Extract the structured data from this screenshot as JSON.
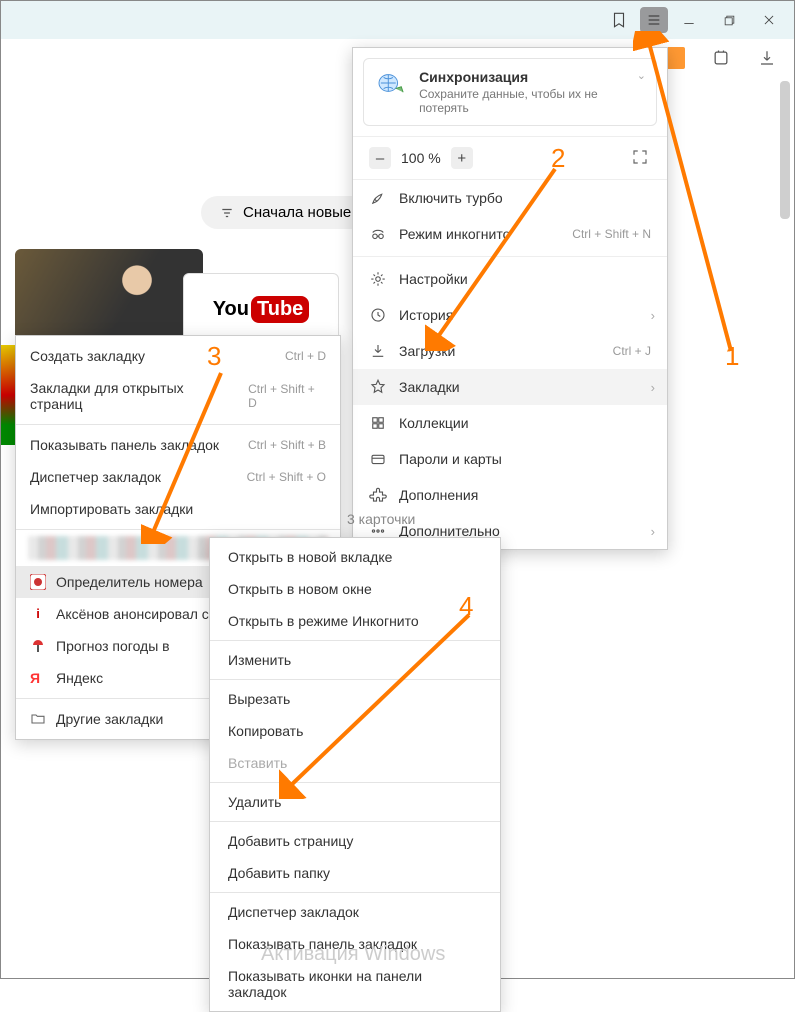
{
  "titlebar": {
    "bookmark_icon": "bookmark",
    "menu_icon": "menu"
  },
  "toolbar": {
    "shield_icon": "shield",
    "extensions_icon": "extensions",
    "download_icon": "download"
  },
  "background": {
    "sort_label": "Сначала новые",
    "youtube_a": "You",
    "youtube_b": "Tube"
  },
  "sync": {
    "title": "Синхронизация",
    "subtitle": "Сохраните данные, чтобы их не потерять"
  },
  "zoom": {
    "minus": "–",
    "value": "100 %",
    "plus": "+"
  },
  "main_menu": {
    "turbo": "Включить турбо",
    "incognito": "Режим инкогнито",
    "incognito_shortcut": "Ctrl + Shift + N",
    "settings": "Настройки",
    "history": "История",
    "downloads": "Загрузки",
    "downloads_shortcut": "Ctrl + J",
    "bookmarks": "Закладки",
    "collections": "Коллекции",
    "passwords": "Пароли и карты",
    "addons": "Дополнения",
    "more": "Дополнительно"
  },
  "bookmarks_menu": {
    "create": "Создать закладку",
    "create_shortcut": "Ctrl + D",
    "create_open": "Закладки для открытых страниц",
    "create_open_shortcut": "Ctrl + Shift + D",
    "show_panel": "Показывать панель закладок",
    "show_panel_shortcut": "Ctrl + Shift + B",
    "manager": "Диспетчер закладок",
    "manager_shortcut": "Ctrl + Shift + O",
    "import": "Импортировать закладки",
    "item_caller": "Определитель номера",
    "item_aksenov": "Аксёнов анонсировал с",
    "item_weather": "Прогноз погоды в",
    "item_yandex": "Яндекс",
    "other": "Другие закладки"
  },
  "context_menu": {
    "open_tab": "Открыть в новой вкладке",
    "open_window": "Открыть в новом окне",
    "open_incognito": "Открыть в режиме Инкогнито",
    "edit": "Изменить",
    "cut": "Вырезать",
    "copy": "Копировать",
    "paste": "Вставить",
    "delete": "Удалить",
    "add_page": "Добавить страницу",
    "add_folder": "Добавить папку",
    "bm_manager": "Диспетчер закладок",
    "show_panel": "Показывать панель закладок",
    "show_icons": "Показывать иконки на панели закладок"
  },
  "cards_label": "3 карточки",
  "annotations": {
    "n1": "1",
    "n2": "2",
    "n3": "3",
    "n4": "4"
  },
  "watermark": "Активация Windows"
}
